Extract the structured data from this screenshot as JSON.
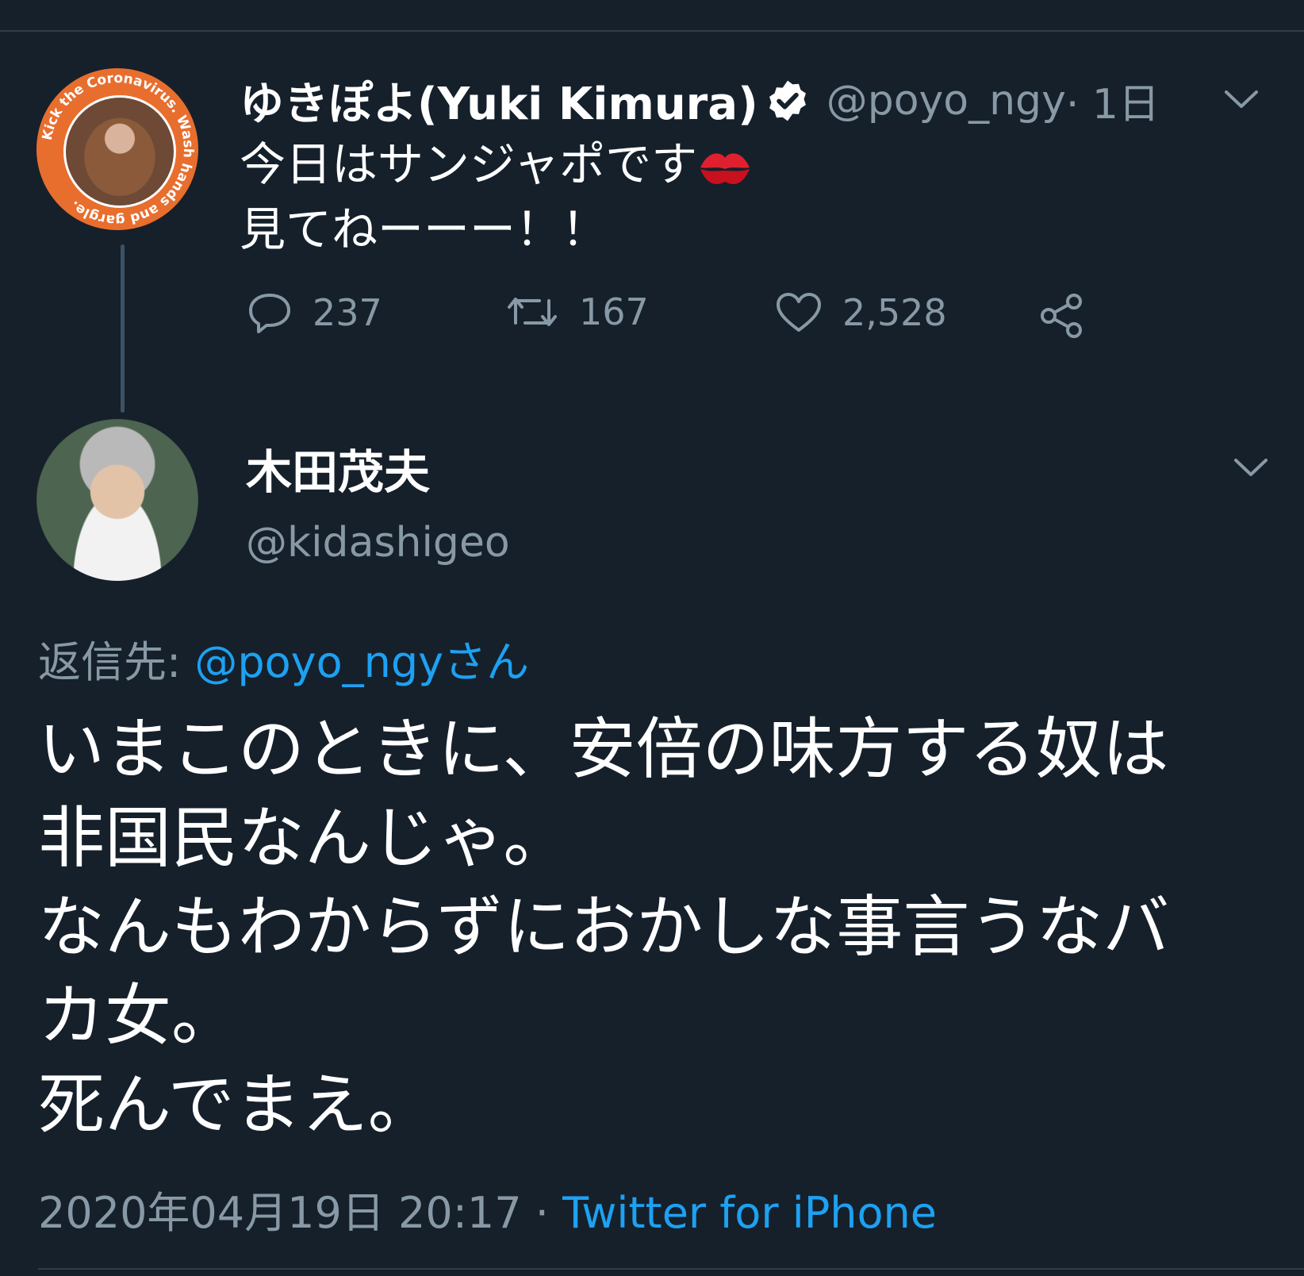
{
  "tweet1": {
    "name": "ゆきぽよ(Yuki Kimura)",
    "handle": "@poyo_ngy",
    "time": " · 1日",
    "text_line1": "今日はサンジャポです",
    "text_line2": "見てねーーー！！",
    "avatar_ring_text": "Kick the Coronavirus. Wash hands and gargle.",
    "counts": {
      "replies": "237",
      "retweets": "167",
      "likes": "2,528"
    },
    "icons": {
      "verified": "verified-badge-icon",
      "kiss": "kiss-mark-emoji",
      "reply": "reply-bubble-icon",
      "retweet": "retweet-icon",
      "like": "heart-icon",
      "share": "share-icon",
      "menu": "chevron-down-icon"
    }
  },
  "tweet2": {
    "name": "木田茂夫",
    "handle": "@kidashigeo",
    "reply_to_label": "返信先: ",
    "reply_to_link": "@poyo_ngyさん",
    "body": "いまこのときに、安倍の味方する奴は\n非国民なんじゃ。\nなんもわからずにおかしな事言うなバ\nカ女。\n死んでまえ。",
    "date": "2020年04月19日 20:17",
    "sep": " · ",
    "source": "Twitter for iPhone"
  },
  "colors": {
    "background": "#15202b",
    "secondary_text": "#8899a6",
    "link": "#1da1f2",
    "divider": "#2f3c4a",
    "avatar_ring": "#e86e2e"
  }
}
